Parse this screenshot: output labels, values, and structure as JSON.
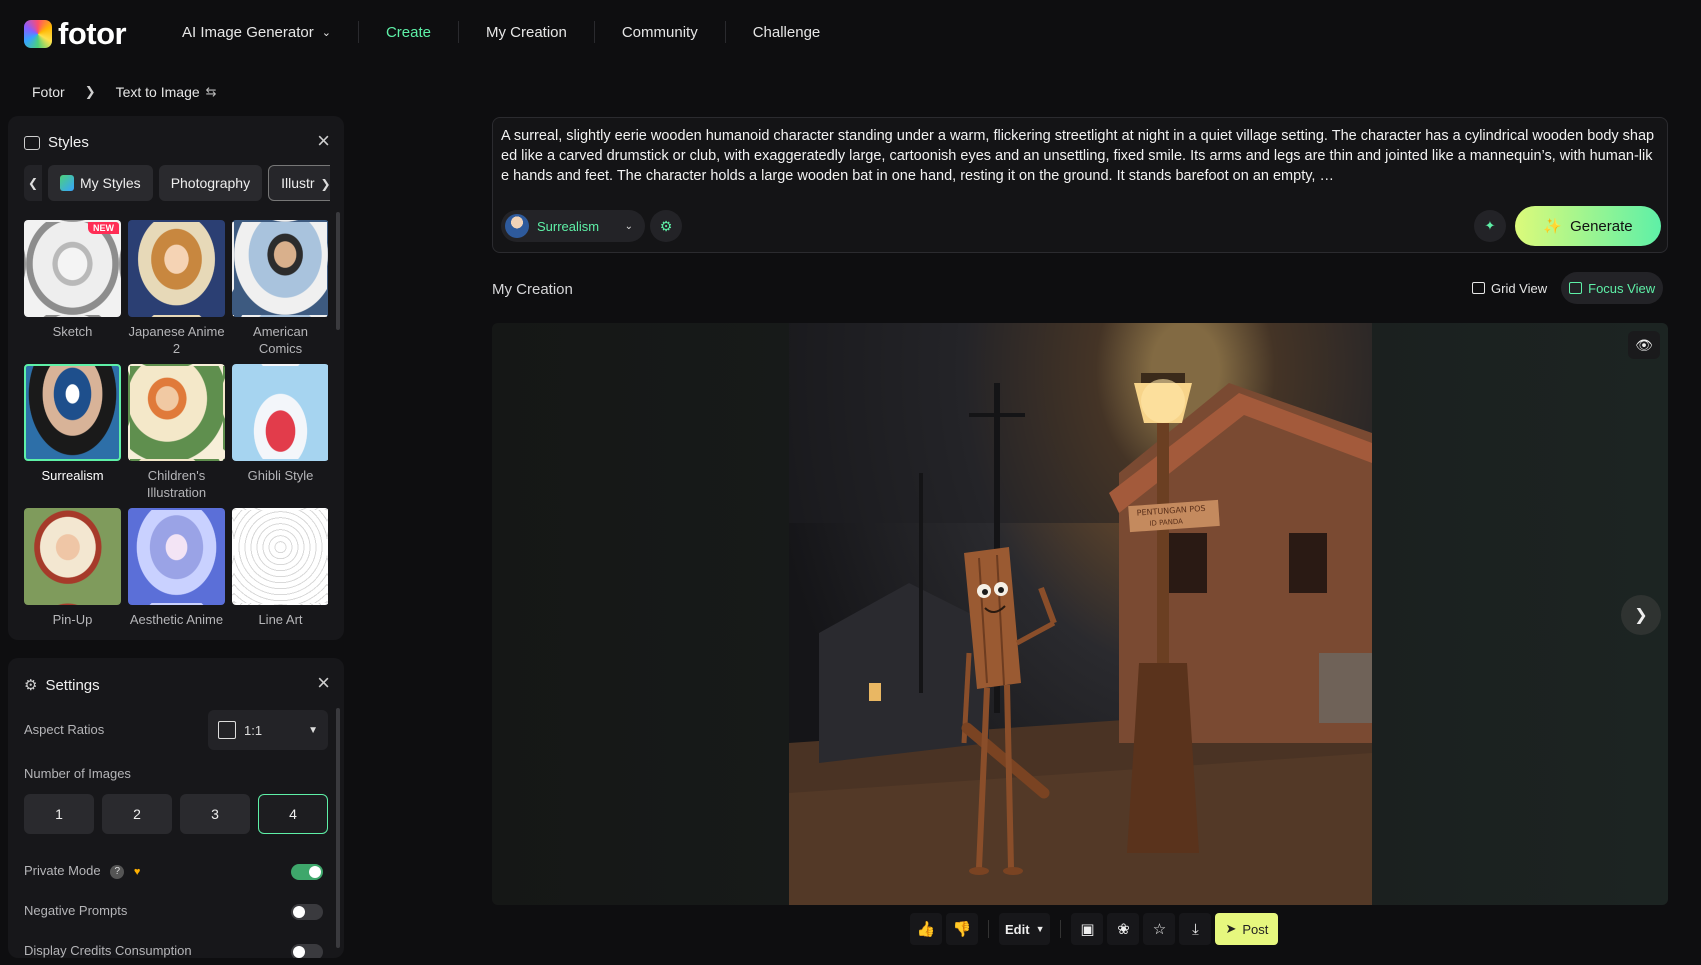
{
  "header": {
    "brand": "fotor",
    "nav": [
      {
        "label": "AI Image Generator",
        "active": false,
        "has_dropdown": true
      },
      {
        "label": "Create",
        "active": true
      },
      {
        "label": "My Creation",
        "active": false
      },
      {
        "label": "Community",
        "active": false
      },
      {
        "label": "Challenge",
        "active": false
      }
    ]
  },
  "breadcrumb": {
    "root": "Fotor",
    "current": "Text to Image"
  },
  "styles_panel": {
    "title": "Styles",
    "tabs": [
      "My Styles",
      "Photography",
      "Illustr"
    ],
    "new_badge": "NEW",
    "styles": [
      {
        "label": "Sketch",
        "selected": false,
        "badge": true
      },
      {
        "label": "Japanese Anime 2",
        "selected": false
      },
      {
        "label": "American Comics",
        "selected": false
      },
      {
        "label": "Surrealism",
        "selected": true
      },
      {
        "label": "Children's Illustration",
        "selected": false
      },
      {
        "label": "Ghibli Style",
        "selected": false
      },
      {
        "label": "Pin-Up",
        "selected": false
      },
      {
        "label": "Aesthetic Anime",
        "selected": false
      },
      {
        "label": "Line Art",
        "selected": false
      }
    ]
  },
  "settings_panel": {
    "title": "Settings",
    "aspect_label": "Aspect Ratios",
    "aspect_value": "1:1",
    "num_images_label": "Number of Images",
    "num_options": [
      "1",
      "2",
      "3",
      "4"
    ],
    "num_selected": "4",
    "private_mode_label": "Private Mode",
    "private_mode_on": true,
    "negative_prompts_label": "Negative Prompts",
    "negative_prompts_on": false,
    "credits_label": "Display Credits Consumption",
    "credits_on": false
  },
  "prompt": {
    "text": "A surreal, slightly eerie wooden humanoid character standing under a warm, flickering streetlight at night in a quiet village setting. The character has a cylindrical wooden body shaped like a carved drumstick or club, with exaggeratedly large, cartoonish eyes and an unsettling, fixed smile. Its arms and legs are thin and jointed like a mannequin’s, with human-like hands and feet. The character holds a large wooden bat in one hand, resting it on the ground. It stands barefoot on an empty, …",
    "style_chip": "Surrealism",
    "generate_label": "Generate"
  },
  "creation": {
    "title": "My Creation",
    "grid_view_label": "Grid View",
    "focus_view_label": "Focus View",
    "sign_text_1": "PENTUNGAN POS",
    "sign_text_2": "ID PANDA"
  },
  "toolbar": {
    "edit_label": "Edit",
    "post_label": "Post"
  },
  "colors": {
    "accent": "#5ef0a7",
    "generate_start": "#dcfa7a",
    "post_bg": "#e6f77e"
  }
}
